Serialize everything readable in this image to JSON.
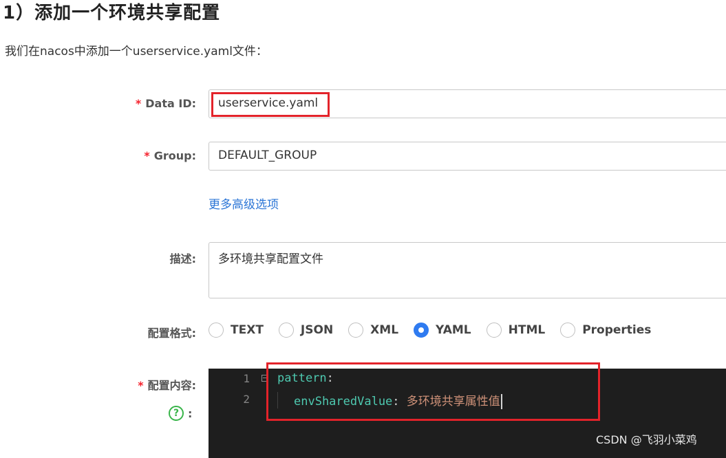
{
  "heading": "1）添加一个环境共享配置",
  "intro": "我们在nacos中添加一个userservice.yaml文件：",
  "form": {
    "data_id": {
      "required": "*",
      "label": "Data ID:",
      "value": "userservice.yaml"
    },
    "group": {
      "required": "*",
      "label": "Group:",
      "value": "DEFAULT_GROUP"
    },
    "advanced_link": "更多高级选项",
    "description": {
      "label": "描述:",
      "value": "多环境共享配置文件"
    },
    "format": {
      "label": "配置格式:",
      "options": [
        "TEXT",
        "JSON",
        "XML",
        "YAML",
        "HTML",
        "Properties"
      ],
      "selected": "YAML"
    },
    "content": {
      "required": "*",
      "label": "配置内容:",
      "help_icon": "?",
      "help_colon": ":",
      "line_numbers": [
        "1",
        "2"
      ],
      "lines": [
        {
          "key": "pattern",
          "colon": ":",
          "value": ""
        },
        {
          "key": "envSharedValue",
          "colon": ": ",
          "value": "多环境共享属性值"
        }
      ]
    }
  },
  "watermark": "CSDN @飞羽小菜鸡",
  "colors": {
    "highlight_border": "#e3232a",
    "radio_selected": "#2f7bf0",
    "link": "#2b75d6",
    "help_icon": "#39b54a"
  }
}
